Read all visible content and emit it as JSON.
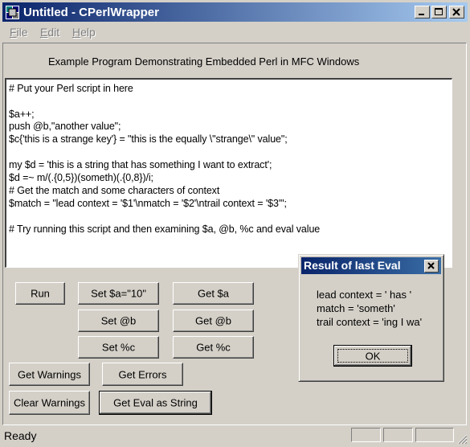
{
  "window": {
    "title": "Untitled - CPerlWrapper",
    "icon": "perl-camel-icon"
  },
  "menu": [
    "File",
    "Edit",
    "Help"
  ],
  "header_label": "Example Program Demonstrating Embedded Perl in MFC Windows",
  "editor": {
    "lines": [
      "# Put your Perl script in here",
      "",
      "$a++;",
      "push @b,\"another value\";",
      "$c{'this is a strange key'} = \"this is the equally \\\"strange\\\" value\";",
      "",
      "my $d = 'this is a string that has something I want to extract';",
      "$d =~ m/(.{0,5})(someth)(.{0,8})/i;",
      "# Get the match and some characters of context",
      "$match = \"lead context = '$1'\\nmatch = '$2'\\ntrail context = '$3'\";",
      "",
      "# Try running this script and then examining $a, @b, %c and eval value"
    ]
  },
  "buttons": {
    "run": "Run",
    "set_a": "Set $a=\"10\"",
    "get_a": "Get $a",
    "set_b": "Set @b",
    "get_b": "Get @b",
    "set_c": "Set %c",
    "get_c": "Get %c",
    "get_warnings": "Get Warnings",
    "get_errors": "Get Errors",
    "clear_warnings": "Clear Warnings",
    "get_eval_string": "Get Eval as String"
  },
  "dialog": {
    "title": "Result of last Eval",
    "lines": [
      "lead context = ' has '",
      "match = 'someth'",
      "trail context = 'ing I wa'"
    ],
    "ok": "OK"
  },
  "status": {
    "text": "Ready"
  },
  "colors": {
    "face": "#d4d0c8",
    "title_active": "#0a246a",
    "title_gradient_end": "#a6caf0"
  }
}
